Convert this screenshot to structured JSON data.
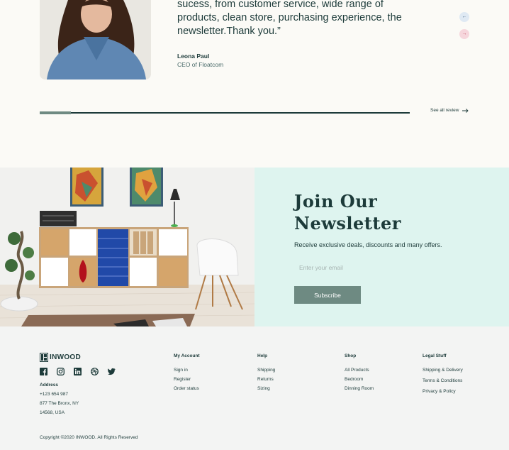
{
  "testimonial": {
    "quote": "sucess, from customer service, wide range of products, clean store, purchasing experience, the newsletter.Thank you.”",
    "author_name": "Leona Paul",
    "author_role": "CEO of Floatcom",
    "prev_icon": "arrow-left-icon",
    "next_icon": "arrow-right-icon",
    "progress": 0.085,
    "see_all_label": "See all review"
  },
  "newsletter": {
    "title_line1": "Join Our",
    "title_line2": "Newsletter",
    "description": "Receive exclusive deals, discounts and many offers.",
    "email_placeholder": "Enter your email",
    "subscribe_label": "Subscribe"
  },
  "footer": {
    "brand": "INWOOD",
    "socials": [
      "facebook-icon",
      "instagram-icon",
      "linkedin-icon",
      "dribbble-icon",
      "twitter-icon"
    ],
    "address_title": "Address",
    "address_lines": [
      "+123 654 987",
      "877  The Bronx, NY",
      "14568, USA"
    ],
    "columns": [
      {
        "title": "My Account",
        "links": [
          "Sign in",
          "Register",
          "Order status"
        ]
      },
      {
        "title": "Help",
        "links": [
          "Shipping",
          "Returns",
          "Sizing"
        ]
      },
      {
        "title": "Shop",
        "links": [
          "All Products",
          "Bedroom",
          "Dinning Room"
        ]
      },
      {
        "title": "Legal Stuff",
        "links": [
          "Shipping & Delivery",
          "Terms & Conditions",
          "Privacy & Policy"
        ]
      }
    ],
    "copyright": "Copyright ©2020 INWOOD. All Rights Reserved"
  },
  "colors": {
    "primary": "#1d3b3a",
    "accent": "#6e8a82",
    "newsletter_bg": "#def4ef",
    "footer_bg": "#f3f4f3"
  }
}
